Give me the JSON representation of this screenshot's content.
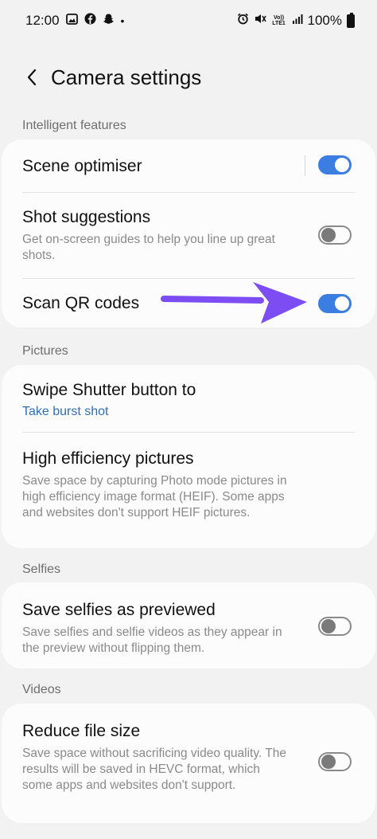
{
  "status_bar": {
    "time": "12:00",
    "battery": "100%",
    "lte_label": "Vo)) LTE1"
  },
  "header": {
    "title": "Camera settings"
  },
  "sections": {
    "intelligent": "Intelligent features",
    "pictures": "Pictures",
    "selfies": "Selfies",
    "videos": "Videos"
  },
  "settings": {
    "scene_optimiser": {
      "title": "Scene optimiser",
      "enabled": true
    },
    "shot_suggestions": {
      "title": "Shot suggestions",
      "description": "Get on-screen guides to help you line up great shots.",
      "enabled": false
    },
    "scan_qr": {
      "title": "Scan QR codes",
      "enabled": true
    },
    "swipe_shutter": {
      "title": "Swipe Shutter button to",
      "value": "Take burst shot"
    },
    "high_efficiency": {
      "title": "High efficiency pictures",
      "description": "Save space by capturing Photo mode pictures in high efficiency image format (HEIF). Some apps and websites don't support HEIF pictures.",
      "enabled": false
    },
    "save_selfies": {
      "title": "Save selfies as previewed",
      "description": "Save selfies and selfie videos as they appear in the preview without flipping them.",
      "enabled": false
    },
    "reduce_file_size": {
      "title": "Reduce file size",
      "description": "Save space without sacrificing video quality. The results will be saved in HEVC format, which some apps and websites don't support.",
      "enabled": false
    }
  },
  "colors": {
    "accent": "#3b7de0",
    "link": "#2f6fb6",
    "annotation_arrow": "#7b4df2"
  }
}
